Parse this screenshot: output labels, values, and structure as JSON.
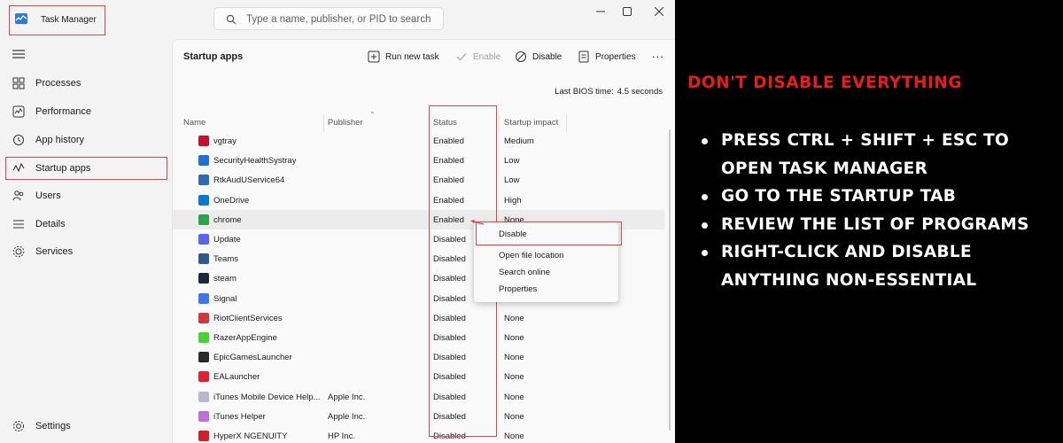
{
  "window": {
    "title": "Task Manager",
    "search_placeholder": "Type a name, publisher, or PID to search"
  },
  "sidebar": {
    "items": [
      {
        "label": "Processes",
        "icon": "processes-icon"
      },
      {
        "label": "Performance",
        "icon": "performance-icon"
      },
      {
        "label": "App history",
        "icon": "app-history-icon"
      },
      {
        "label": "Startup apps",
        "icon": "startup-apps-icon"
      },
      {
        "label": "Users",
        "icon": "users-icon"
      },
      {
        "label": "Details",
        "icon": "details-icon"
      },
      {
        "label": "Services",
        "icon": "services-icon"
      }
    ],
    "settings_label": "Settings"
  },
  "main": {
    "page_title": "Startup apps",
    "toolbar": {
      "run_new_task": "Run new task",
      "enable": "Enable",
      "disable": "Disable",
      "properties": "Properties",
      "more": "..."
    },
    "bios_label": "Last BIOS time:",
    "bios_value": "4.5 seconds",
    "columns": {
      "name": "Name",
      "publisher": "Publisher",
      "status": "Status",
      "impact": "Startup impact"
    },
    "rows": [
      {
        "name": "vgtray",
        "publisher": "",
        "status": "Enabled",
        "impact": "Medium",
        "color": "#c8102e"
      },
      {
        "name": "SecurityHealthSystray",
        "publisher": "",
        "status": "Enabled",
        "impact": "Low",
        "color": "#1e6fd9"
      },
      {
        "name": "RtkAudUService64",
        "publisher": "",
        "status": "Enabled",
        "impact": "Low",
        "color": "#2a6db5"
      },
      {
        "name": "OneDrive",
        "publisher": "",
        "status": "Enabled",
        "impact": "High",
        "color": "#0a78d4"
      },
      {
        "name": "chrome",
        "publisher": "",
        "status": "Enabled",
        "impact": "None",
        "color": "#2ba24c"
      },
      {
        "name": "Update",
        "publisher": "",
        "status": "Disabled",
        "impact": "",
        "color": "#5865f2"
      },
      {
        "name": "Teams",
        "publisher": "",
        "status": "Disabled",
        "impact": "",
        "color": "#2f5a8c"
      },
      {
        "name": "steam",
        "publisher": "",
        "status": "Disabled",
        "impact": "",
        "color": "#1b2838"
      },
      {
        "name": "Signal",
        "publisher": "",
        "status": "Disabled",
        "impact": "",
        "color": "#3a76f0"
      },
      {
        "name": "RiotClientServices",
        "publisher": "",
        "status": "Disabled",
        "impact": "None",
        "color": "#d13639"
      },
      {
        "name": "RazerAppEngine",
        "publisher": "",
        "status": "Disabled",
        "impact": "None",
        "color": "#44d62c"
      },
      {
        "name": "EpicGamesLauncher",
        "publisher": "",
        "status": "Disabled",
        "impact": "None",
        "color": "#2a2a2a"
      },
      {
        "name": "EALauncher",
        "publisher": "",
        "status": "Disabled",
        "impact": "None",
        "color": "#e4202e"
      },
      {
        "name": "iTunes Mobile Device Help...",
        "publisher": "Apple Inc.",
        "status": "Disabled",
        "impact": "None",
        "color": "#b9b9c9"
      },
      {
        "name": "iTunes Helper",
        "publisher": "Apple Inc.",
        "status": "Disabled",
        "impact": "None",
        "color": "#c06fd8"
      },
      {
        "name": "HyperX NGENUITY",
        "publisher": "HP Inc.",
        "status": "Disabled",
        "impact": "None",
        "color": "#d0202a"
      }
    ]
  },
  "context_menu": {
    "items": [
      "Disable",
      "Open file location",
      "Search online",
      "Properties"
    ]
  },
  "overlay": {
    "heading": "DON'T DISABLE EVERYTHING",
    "bullets": [
      "PRESS CTRL + SHIFT + ESC TO OPEN TASK MANAGER",
      "GO TO THE STARTUP TAB",
      "REVIEW THE LIST OF PROGRAMS",
      "RIGHT-CLICK AND DISABLE ANYTHING NON-ESSENTIAL"
    ],
    "heading_color": "#e81c1c",
    "highlight_color": "#e0474c"
  }
}
